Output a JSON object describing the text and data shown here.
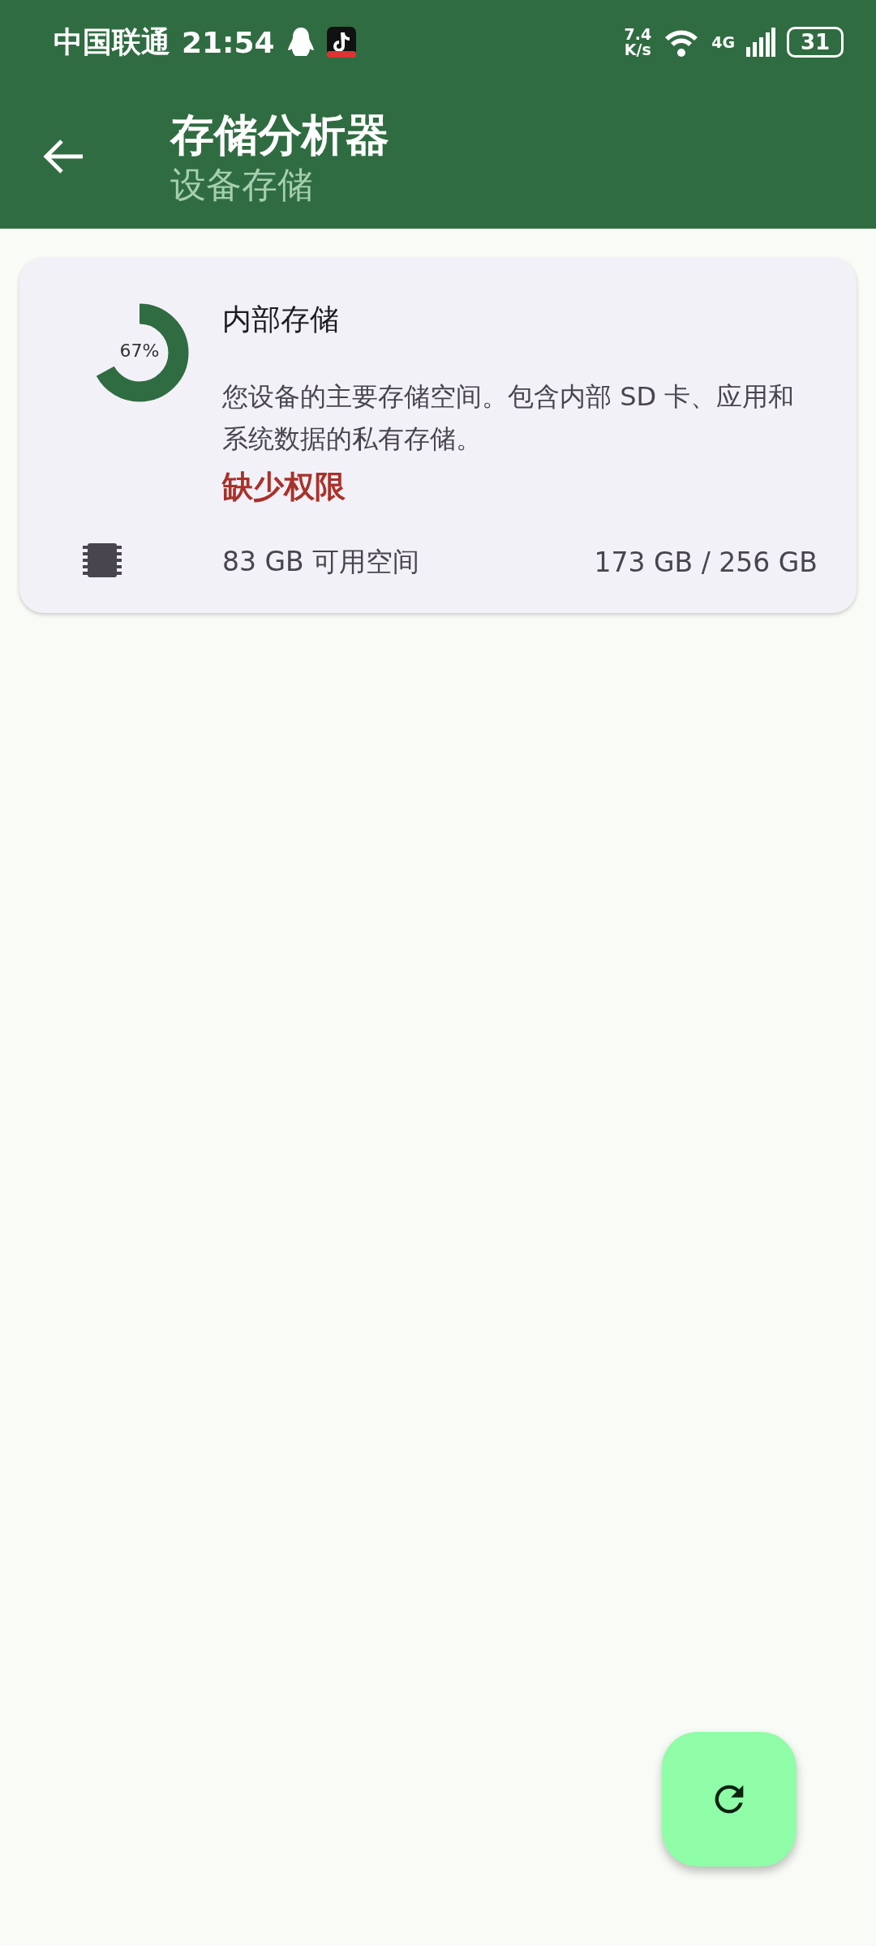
{
  "status_bar": {
    "carrier": "中国联通",
    "time": "21:54",
    "speed_value": "7.4",
    "speed_unit": "K/s",
    "network": "4G",
    "battery": "31"
  },
  "app_bar": {
    "title": "存储分析器",
    "subtitle": "设备存储"
  },
  "storage_cards": [
    {
      "title": "内部存储",
      "percent": "67%",
      "level": 0.67,
      "description": "您设备的主要存储空间。包含内部 SD 卡、应用和系统数据的私有存储。",
      "warning": "缺少权限",
      "free": "83 GB 可用空间",
      "usage": "173 GB / 256 GB"
    }
  ]
}
